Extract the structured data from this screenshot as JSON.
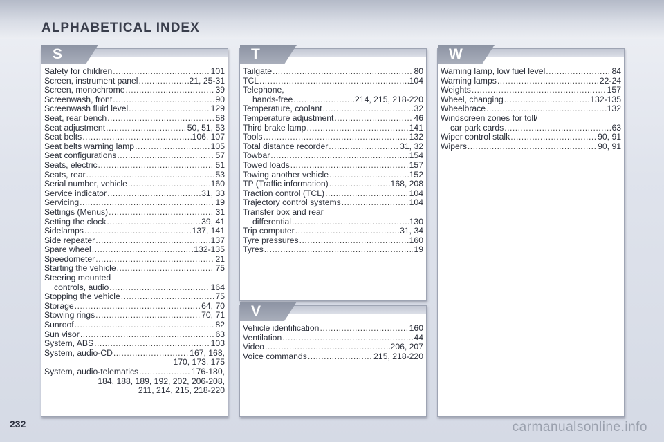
{
  "header": {
    "title": "ALPHABETICAL INDEX"
  },
  "page_number": "232",
  "watermark": "carmanualsonline.info",
  "sections": {
    "S": {
      "letter": "S",
      "entries": [
        {
          "name": "Safety for children",
          "pages": "101"
        },
        {
          "name": "Screen, instrument panel",
          "pages": "21, 25-31"
        },
        {
          "name": "Screen, monochrome",
          "pages": "39"
        },
        {
          "name": "Screenwash, front",
          "pages": "90"
        },
        {
          "name": "Screenwash fluid level",
          "pages": "129"
        },
        {
          "name": "Seat, rear bench",
          "pages": "58"
        },
        {
          "name": "Seat adjustment",
          "pages": "50, 51, 53"
        },
        {
          "name": "Seat belts",
          "pages": "106, 107"
        },
        {
          "name": "Seat belts warning lamp",
          "pages": "105"
        },
        {
          "name": "Seat configurations",
          "pages": "57"
        },
        {
          "name": "Seats, electric",
          "pages": "51"
        },
        {
          "name": "Seats, rear",
          "pages": "53"
        },
        {
          "name": "Serial number, vehicle",
          "pages": "160"
        },
        {
          "name": "Service indicator",
          "pages": "31, 33"
        },
        {
          "name": "Servicing",
          "pages": "19"
        },
        {
          "name": "Settings (Menus)",
          "pages": "31"
        },
        {
          "name": "Setting the clock",
          "pages": "39, 41"
        },
        {
          "name": "Sidelamps",
          "pages": "137, 141"
        },
        {
          "name": "Side repeater",
          "pages": "137"
        },
        {
          "name": "Spare wheel",
          "pages": "132-135"
        },
        {
          "name": "Speedometer",
          "pages": "21"
        },
        {
          "name": "Starting the vehicle",
          "pages": "75"
        }
      ],
      "steering_head": "Steering mounted",
      "steering_entry": {
        "name": "controls, audio",
        "pages": "164"
      },
      "entries_b": [
        {
          "name": "Stopping the vehicle",
          "pages": "75"
        },
        {
          "name": "Storage",
          "pages": "64, 70"
        },
        {
          "name": "Stowing rings",
          "pages": "70, 71"
        },
        {
          "name": "Sunroof",
          "pages": "82"
        },
        {
          "name": "Sun visor",
          "pages": "63"
        },
        {
          "name": "System, ABS",
          "pages": "103"
        },
        {
          "name": "System, audio-CD",
          "pages": "167, 168,"
        }
      ],
      "audio_cd_cont": "170, 173, 175",
      "telematics_entry": {
        "name": "System, audio-telematics",
        "pages": "176-180,"
      },
      "telematics_cont1": "184, 188, 189, 192, 202, 206-208,",
      "telematics_cont2": "211, 214, 215, 218-220"
    },
    "T": {
      "letter": "T",
      "entries_a": [
        {
          "name": "Tailgate",
          "pages": "80"
        },
        {
          "name": "TCL",
          "pages": "104"
        }
      ],
      "telephone_head": "Telephone,",
      "telephone_entry": {
        "name": "hands-free",
        "pages": "214, 215, 218-220"
      },
      "entries_b": [
        {
          "name": "Temperature, coolant",
          "pages": "32"
        },
        {
          "name": "Temperature adjustment",
          "pages": "46"
        },
        {
          "name": "Third brake lamp",
          "pages": "141"
        },
        {
          "name": "Tools",
          "pages": "132"
        },
        {
          "name": "Total distance recorder",
          "pages": "31, 32"
        },
        {
          "name": "Towbar",
          "pages": "154"
        },
        {
          "name": "Towed loads",
          "pages": "157"
        },
        {
          "name": "Towing another vehicle",
          "pages": "152"
        },
        {
          "name": "TP (Traffic information)",
          "pages": "168, 208"
        },
        {
          "name": "Traction control (TCL)",
          "pages": "104"
        },
        {
          "name": "Trajectory control systems",
          "pages": "104"
        }
      ],
      "transfer_head": "Transfer box and rear",
      "transfer_entry": {
        "name": "differential",
        "pages": "130"
      },
      "entries_c": [
        {
          "name": "Trip computer",
          "pages": "31, 34"
        },
        {
          "name": "Tyre pressures",
          "pages": "160"
        },
        {
          "name": "Tyres",
          "pages": "19"
        }
      ]
    },
    "V": {
      "letter": "V",
      "entries": [
        {
          "name": "Vehicle identification",
          "pages": "160"
        },
        {
          "name": "Ventilation",
          "pages": "44"
        },
        {
          "name": "Video",
          "pages": "206, 207"
        },
        {
          "name": "Voice commands",
          "pages": "215, 218-220"
        }
      ]
    },
    "W": {
      "letter": "W",
      "entries_a": [
        {
          "name": "Warning lamp, low fuel level",
          "pages": "84"
        },
        {
          "name": "Warning lamps",
          "pages": "22-24"
        },
        {
          "name": "Weights",
          "pages": "157"
        },
        {
          "name": "Wheel, changing",
          "pages": "132-135"
        },
        {
          "name": "Wheelbrace",
          "pages": "132"
        }
      ],
      "windscreen_head": "Windscreen zones for toll/",
      "windscreen_entry": {
        "name": "car park cards",
        "pages": "63"
      },
      "entries_b": [
        {
          "name": "Wiper control stalk",
          "pages": "90, 91"
        },
        {
          "name": "Wipers",
          "pages": "90, 91"
        }
      ]
    }
  }
}
